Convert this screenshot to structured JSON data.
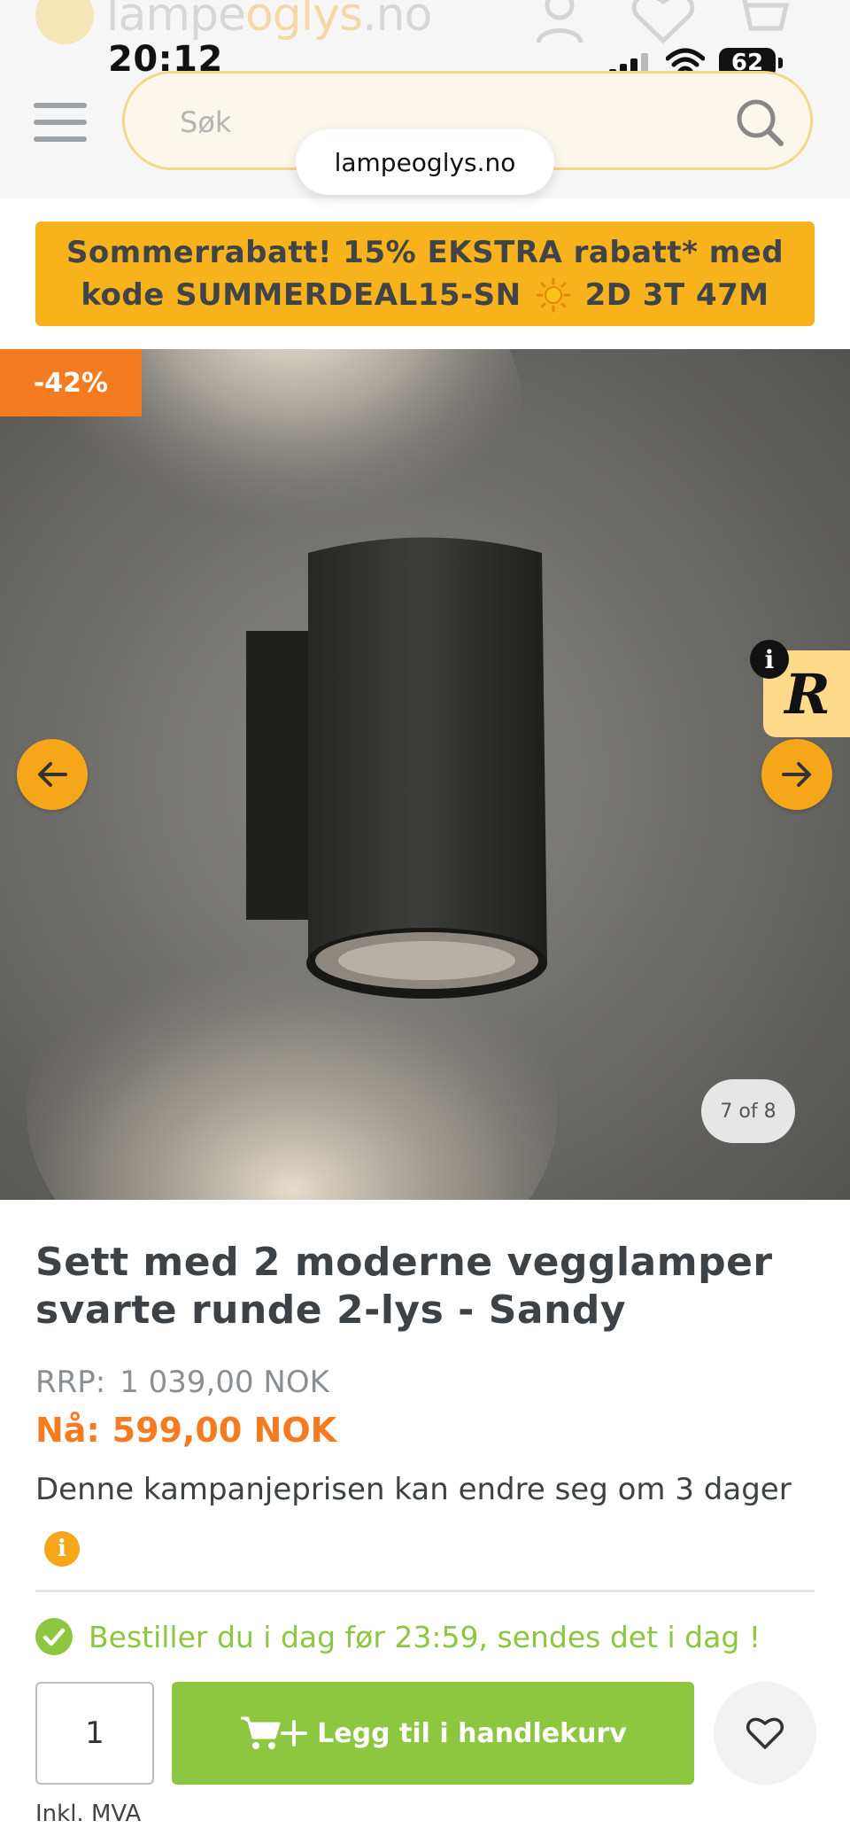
{
  "status_bar": {
    "time": "20:12",
    "battery": "62"
  },
  "header": {
    "logo_text_main": "lampe",
    "logo_text_accent": "oglys",
    "logo_text_tld": ".no",
    "search_placeholder": "Søk",
    "url": "lampeoglys.no"
  },
  "promo": {
    "line1": "Sommerrabatt! 15% EKSTRA rabatt* med",
    "line2": "kode SUMMERDEAL15-SN",
    "countdown": "2D 3T 47M"
  },
  "gallery": {
    "discount_badge": "-42%",
    "counter": "7 of 8",
    "reviews_widget_letter": "R",
    "reviews_info": "i"
  },
  "product": {
    "title": "Sett med 2 moderne vegglamper svarte runde 2-lys - Sandy",
    "rrp_label": "RRP:",
    "rrp_value": "1 039,00 NOK",
    "price_label": "Nå:",
    "price_value": "599,00 NOK",
    "campaign_note": "Denne kampanjeprisen kan endre seg om 3 dager",
    "info_icon": "i",
    "shipping_note": "Bestiller du i dag før 23:59, sendes det i dag !",
    "quantity": "1",
    "add_to_cart_label": "Legg til i handlekurv",
    "vat_note": "Inkl. MVA"
  },
  "colors": {
    "accent_orange": "#f6a619",
    "discount_orange": "#f47b20",
    "success_green": "#8dc63f",
    "promo_yellow": "#f8b31c"
  },
  "icons": [
    "menu-icon",
    "search-icon",
    "user-icon",
    "heart-icon",
    "cart-icon",
    "sun-icon",
    "arrow-left-icon",
    "arrow-right-icon",
    "check-circle-icon",
    "cart-plus-icon",
    "info-icon"
  ]
}
